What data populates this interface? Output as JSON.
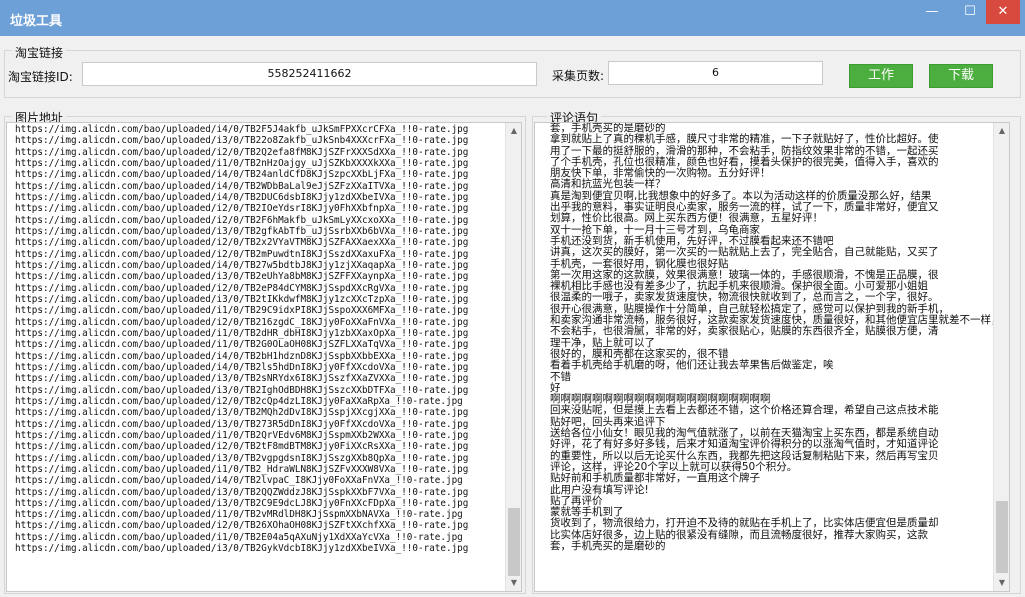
{
  "window": {
    "title": "垃圾工具",
    "min_glyph": "—",
    "max_glyph": "☐",
    "close_glyph": "✕"
  },
  "taobao_group": {
    "label": "淘宝链接",
    "link_id_label": "淘宝链接ID:",
    "link_id_value": "558252411662",
    "pages_label": "采集页数:",
    "pages_value": "6",
    "work_button": "工作",
    "download_button": "下载",
    "accent_green": "#4cae3f"
  },
  "image_group": {
    "label": "图片地址",
    "urls": [
      "https://img.alicdn.com/bao/uploaded/i4/0/TB2F5J4akfb_uJkSmFPXXcrCFXa_!!0-rate.jpg",
      "https://img.alicdn.com/bao/uploaded/i3/0/TB22o8Zakfb_uJkSnb4XXXcrFXa_!!0-rate.jpg",
      "https://img.alicdn.com/bao/uploaded/i2/0/TB2Q2efa8fM8KJjSZFrXXXSdXXa_!!0-rate.jpg",
      "https://img.alicdn.com/bao/uploaded/i1/0/TB2nHzOajgy_uJjSZKbXXXXkXXa_!!0-rate.jpg",
      "https://img.alicdn.com/bao/uploaded/i4/0/TB24anldCfD8KJjSzpcXXbLjFXa_!!0-rate.jpg",
      "https://img.alicdn.com/bao/uploaded/i4/0/TB2WDbBaLal9eJjSZFzXXaITVXa_!!0-rate.jpg",
      "https://img.alicdn.com/bao/uploaded/i4/0/TB2DUC6dsbI8KJjy1zdXXbeIVXa_!!0-rate.jpg",
      "https://img.alicdn.com/bao/uploaded/i2/0/TB2IOeYdsrI8KJjy0FhXXbfnpXa_!!0-rate.jpg",
      "https://img.alicdn.com/bao/uploaded/i2/0/TB2F6hMakfb_uJkSmLyXXcxoXXa_!!0-rate.jpg",
      "https://img.alicdn.com/bao/uploaded/i3/0/TB2gfkAbTfb_uJjSsrbXXb6bVXa_!!0-rate.jpg",
      "https://img.alicdn.com/bao/uploaded/i2/0/TB2x2VYaVTM8KJjSZFAXXaexXXa_!!0-rate.jpg",
      "https://img.alicdn.com/bao/uploaded/i2/0/TB2mPuwdtnI8KJjSszdXXaxuFXa_!!0-rate.jpg",
      "https://img.alicdn.com/bao/uploaded/i4/0/TB27w5bdtbJ8KJjy1zjXXaqapXa_!!0-rate.jpg",
      "https://img.alicdn.com/bao/uploaded/i3/0/TB2eUhYa8bM8KJjSZFFXXaynpXa_!!0-rate.jpg",
      "https://img.alicdn.com/bao/uploaded/i2/0/TB2eP84dCYM8KJjSspdXXcRgVXa_!!0-rate.jpg",
      "https://img.alicdn.com/bao/uploaded/i3/0/TB2tIKkdwfM8KJjy1zcXXcTzpXa_!!0-rate.jpg",
      "https://img.alicdn.com/bao/uploaded/i1/0/TB29C9idxPI8KJjSspoXXX6MFXa_!!0-rate.jpg",
      "https://img.alicdn.com/bao/uploaded/i2/0/TB216zgdC_I8KJjy0FoXXaFnVXa_!!0-rate.jpg",
      "https://img.alicdn.com/bao/uploaded/i1/0/TB2dHR_dbHI8KJjy1zbXXaxOpXa_!!0-rate.jpg",
      "https://img.alicdn.com/bao/uploaded/i1/0/TB2G0OLaOH08KJjSZFLXXaTqVXa_!!0-rate.jpg",
      "https://img.alicdn.com/bao/uploaded/i4/0/TB2bH1hdznD8KJjSspbXXbbEXXa_!!0-rate.jpg",
      "https://img.alicdn.com/bao/uploaded/i4/0/TB2ls5hdDnI8KJjy0FfXXcdoVXa_!!0-rate.jpg",
      "https://img.alicdn.com/bao/uploaded/i3/0/TB2sNRYdx6I8KJjSszfXXaZVXXa_!!0-rate.jpg",
      "https://img.alicdn.com/bao/uploaded/i3/0/TB2IghOdBDH8KJjSszcXXbDTFXa_!!0-rate.jpg",
      "https://img.alicdn.com/bao/uploaded/i2/0/TB2cQp4dzLI8KJjy0FaXXaRpXa_!!0-rate.jpg",
      "https://img.alicdn.com/bao/uploaded/i3/0/TB2MQh2dDvI8KJjSspjXXcgjXXa_!!0-rate.jpg",
      "https://img.alicdn.com/bao/uploaded/i3/0/TB273R5dDnI8KJjy0FfXXcdoVXa_!!0-rate.jpg",
      "https://img.alicdn.com/bao/uploaded/i1/0/TB2QrVEdv6M8KJjSspmXXb2WXXa_!!0-rate.jpg",
      "https://img.alicdn.com/bao/uploaded/i2/0/TB2tF8mdBTM8KJjy0FiXXcRsXXa_!!0-rate.jpg",
      "https://img.alicdn.com/bao/uploaded/i3/0/TB2vgpgdsnI8KJjSszgXXb8QpXa_!!0-rate.jpg",
      "https://img.alicdn.com/bao/uploaded/i1/0/TB2_HdraWLN8KJjSZFvXXXW8VXa_!!0-rate.jpg",
      "https://img.alicdn.com/bao/uploaded/i4/0/TB2lvpaC_I8KJjy0FoXXaFnVXa_!!0-rate.jpg",
      "https://img.alicdn.com/bao/uploaded/i3/0/TB2QQZWddzJ8KJjSspkXXbF7VXa_!!0-rate.jpg",
      "https://img.alicdn.com/bao/uploaded/i3/0/TB2C9E9dcLJ8KJjy0FnXXcFDpXa_!!0-rate.jpg",
      "https://img.alicdn.com/bao/uploaded/i1/0/TB2vMRdlDH8KJjSspmXXbNAVXa_!!0-rate.jpg",
      "https://img.alicdn.com/bao/uploaded/i2/0/TB26XOhaOH08KJjSZFtXXchfXXa_!!0-rate.jpg",
      "https://img.alicdn.com/bao/uploaded/i1/0/TB2E04a5qAXuNjy1XdXXaYcVXa_!!0-rate.jpg",
      "https://img.alicdn.com/bao/uploaded/i3/0/TB2GykVdcbI8KJjy1zdXXbeIVXa_!!0-rate.jpg"
    ]
  },
  "comment_group": {
    "label": "评论语句",
    "lines": [
      "套，手机壳买的是磨砂的",
      "拿到就贴上了真的稞机手感，膜尺寸非常的精准，一下子就贴好了，性价比超好。使",
      "用了一下最的挺舒服的，滑滑的那种，不会粘手，防指纹效果非常的不错，一起还买",
      "了个手机壳，孔位也很精准，颜色也好看，摸着头保护的很完美，值得入手，喜欢的",
      "朋友快下单，非常偷快的一次购物。五分好评！",
      "高清和抗蓝光包装一样？",
      "真是淘到便宜贝啊,比我想象中的好多了。本以为活动这样的价质量没那么好，结果",
      "出乎我的意料，事实证明良心卖家，服务一流的样，试了一下，质量非常好，便宜又",
      "划算，性价比很高。网上买东西方便！很满意，五星好评！",
      "双十一抢下单，十一月十三号才到，乌龟商家",
      "手机还没到货，新手机使用，先好评，不过膜看起来还不错吧",
      "讲真，这次买的膜好，第一次买的一贴就贴上去了，完全贴合，自己就能贴，又买了",
      "手机壳，一套很好用，钢化膜也很好贴",
      "第一次用这家的这款膜，效果很满意！玻璃一体的，手感很顺滑，不愧是正品膜，很",
      "裸机相比手感也没有差多少了，抗起手机来很顺滑。保护很全面。小可爱那小姐姐",
      "很温柔的一哦子，卖家发货速度快，物流很快就收到了，总而言之，一个字，很好。",
      "很开心很满意，贴膜操作十分简单，自己就轻松搞定了，感觉可以保护到我的新手机，",
      "和卖家沟通非常流畅，服务很好，这款卖家发货速度快，质量很好，和其他便宜店里就差不一样，上漫",
      "不会粘手，也很滑腻，非常的好，卖家很贴心，贴膜的东西很齐全，贴膜很方便，清",
      "理干净，贴上就可以了",
      "很好的，膜和壳都在这家买的，很不错",
      "看着手机壳给手机磨的呀，他们还让我去苹果售后做鉴定，唉",
      "不错",
      "好",
      "啊啊啊啊啊啊啊啊啊啊啊啊啊啊啊啊啊啊啊啊啊",
      "回来没贴呢，但是摸上去看上去都还不错，这个价格还算合理，希望自己这点技术能",
      "贴好吧，回头再来追评下",
      "送给各位小仙女！眼见我的淘气值就涨了，以前在天猫淘宝上买东西，都是系统自动",
      "好评，花了有好多好多钱，后来才知道淘宝评价得积分的以涨淘气值时，才知道评论",
      "的重要性，所以以后无论买什么东西，我都先把这段话复制粘贴下来，然后再写宝贝",
      "评论，这样，评论20个字以上就可以获得50个积分。",
      "贴好前和手机质量都非常好，一直用这个牌子",
      "此用户没有填写评论!",
      "贴了再评价",
      "蒙就等手机到了",
      "货收到了，物流很给力，打开迫不及待的就贴在手机上了，比实体店便宜但是质量却",
      "比实体店好很多，边上贴的很紧没有缝隙，而且流畅度很好，推荐大家购买，这款",
      "套，手机壳买的是磨砂的"
    ]
  }
}
